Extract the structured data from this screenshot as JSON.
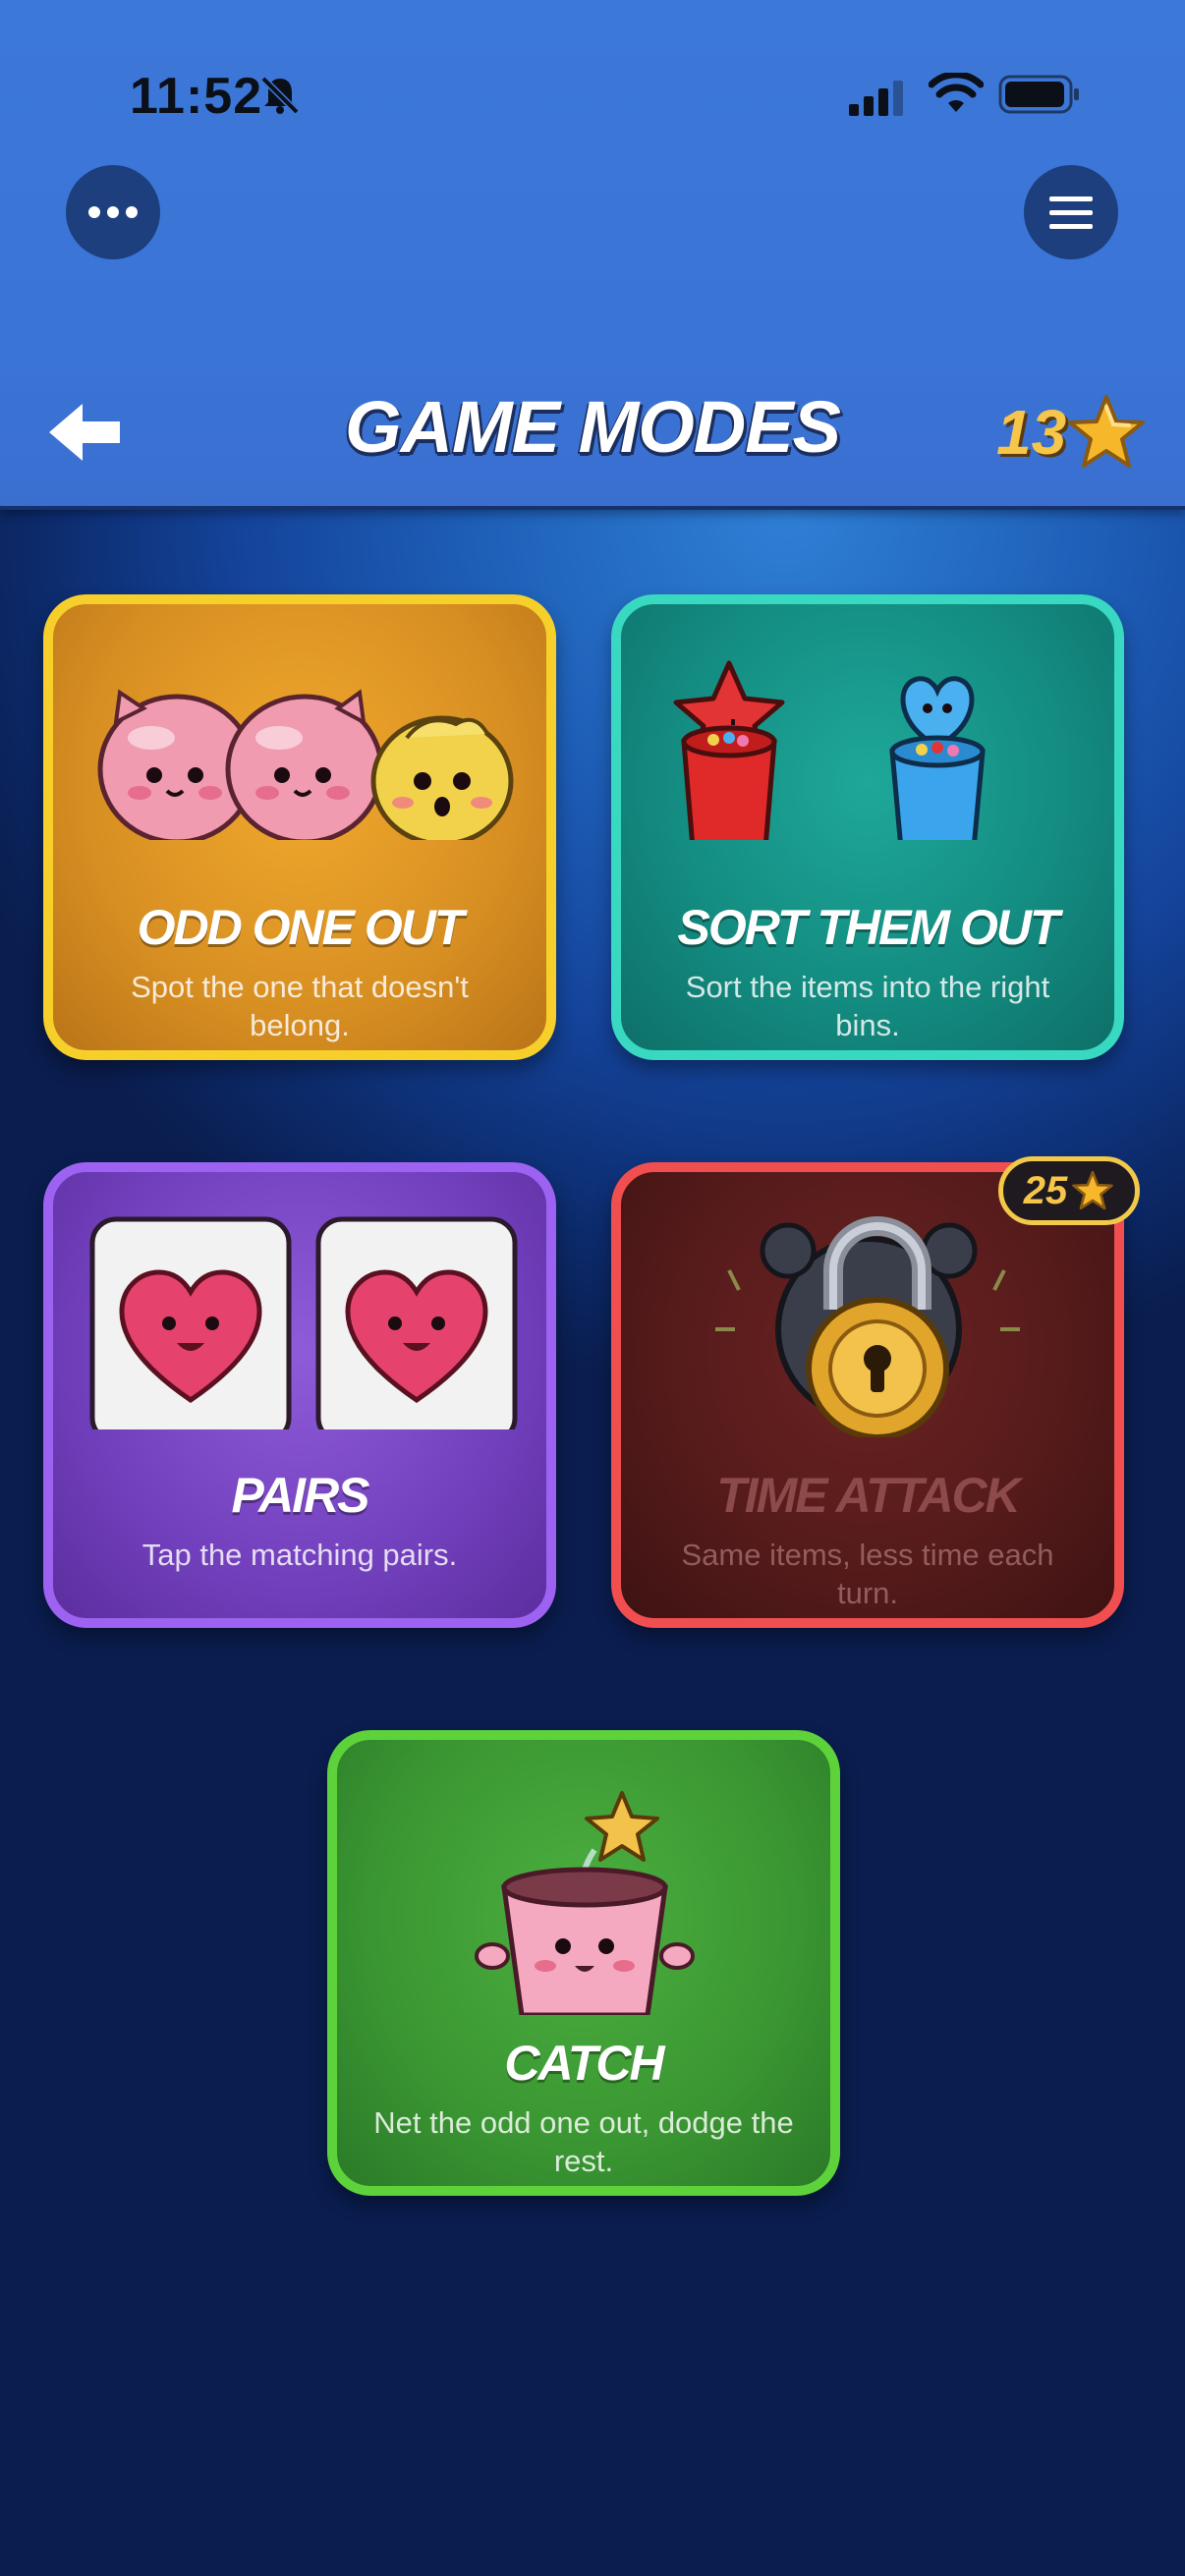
{
  "status": {
    "time": "11:52"
  },
  "header": {
    "title": "GAME MODES",
    "stars": "13"
  },
  "modes": [
    {
      "title": "ODD ONE OUT",
      "desc": "Spot the one that doesn't belong."
    },
    {
      "title": "SORT THEM OUT",
      "desc": "Sort the items into the right bins."
    },
    {
      "title": "PAIRS",
      "desc": "Tap the matching pairs."
    },
    {
      "title": "TIME ATTACK",
      "desc": "Same items, less time each turn.",
      "cost": "25",
      "locked": true
    },
    {
      "title": "CATCH",
      "desc": "Net the odd one out, dodge the rest."
    }
  ],
  "icons": {
    "more": "more-dots-icon",
    "menu": "hamburger-menu-icon",
    "back": "back-arrow-icon",
    "star": "star-icon",
    "lock": "padlock-icon"
  },
  "colors": {
    "accent_star": "#f6c64a",
    "odd": "#f7cf2b",
    "sort": "#38d9c0",
    "pairs": "#9d62f1",
    "time": "#f14f4f",
    "catch": "#5ed23a"
  }
}
